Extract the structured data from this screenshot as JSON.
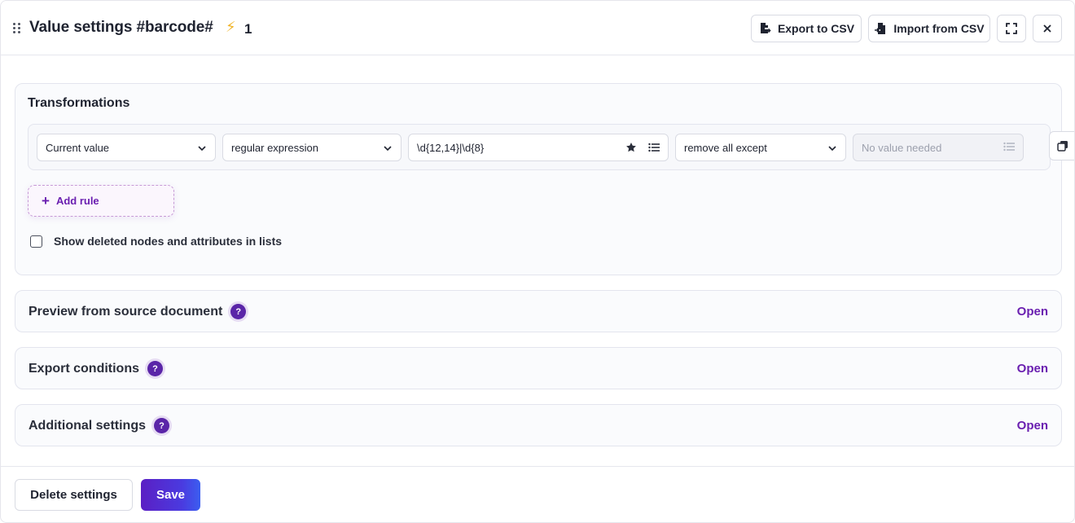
{
  "header": {
    "title": "Value settings #barcode#",
    "bolt_icon": "lightning-icon",
    "bolt_count": "1",
    "export_label": "Export to CSV",
    "import_label": "Import from CSV"
  },
  "transformations": {
    "title": "Transformations",
    "rule": {
      "source": "Current value",
      "method": "regular expression",
      "pattern": "\\d{12,14}|\\d{8}",
      "action": "remove all except",
      "value_placeholder": "No value needed"
    },
    "add_rule_label": "Add rule",
    "show_deleted_label": "Show deleted nodes and attributes in lists",
    "show_deleted_checked": false
  },
  "sections": [
    {
      "title": "Preview from source document",
      "help": "?",
      "action": "Open"
    },
    {
      "title": "Export conditions",
      "help": "?",
      "action": "Open"
    },
    {
      "title": "Additional settings",
      "help": "?",
      "action": "Open"
    }
  ],
  "footer": {
    "delete_label": "Delete settings",
    "save_label": "Save"
  },
  "colors": {
    "accent": "#6a1fb0",
    "help_badge": "#5a25a8",
    "save_gradient_start": "#5b1fc4",
    "save_gradient_end": "#3b5ef0"
  }
}
